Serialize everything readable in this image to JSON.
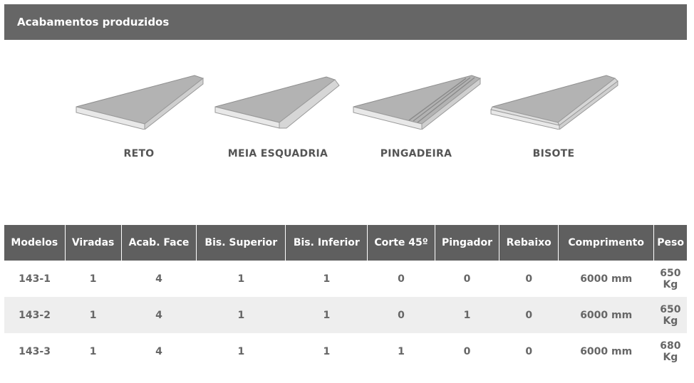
{
  "section": {
    "title": "Acabamentos produzidos"
  },
  "finishes": [
    {
      "label": "RETO",
      "icon": "straight-edge-slab-icon"
    },
    {
      "label": "MEIA ESQUADRIA",
      "icon": "mitered-edge-slab-icon"
    },
    {
      "label": "PINGADEIRA",
      "icon": "drip-edge-slab-icon"
    },
    {
      "label": "BISOTE",
      "icon": "beveled-edge-slab-icon"
    }
  ],
  "table": {
    "headers": [
      "Modelos",
      "Viradas",
      "Acab. Face",
      "Bis. Superior",
      "Bis. Inferior",
      "Corte 45º",
      "Pingador",
      "Rebaixo",
      "Comprimento",
      "Peso"
    ],
    "rows": [
      [
        "143-1",
        "1",
        "4",
        "1",
        "1",
        "0",
        "0",
        "0",
        "6000 mm",
        "650 Kg"
      ],
      [
        "143-2",
        "1",
        "4",
        "1",
        "1",
        "0",
        "1",
        "0",
        "6000 mm",
        "650 Kg"
      ],
      [
        "143-3",
        "1",
        "4",
        "1",
        "1",
        "1",
        "0",
        "0",
        "6000 mm",
        "680 Kg"
      ]
    ]
  },
  "colors": {
    "header_bg": "#666666",
    "table_header_bg": "#5f5f5f",
    "alt_row_bg": "#eeeeee",
    "slab_fill": "#b5b5b5"
  }
}
